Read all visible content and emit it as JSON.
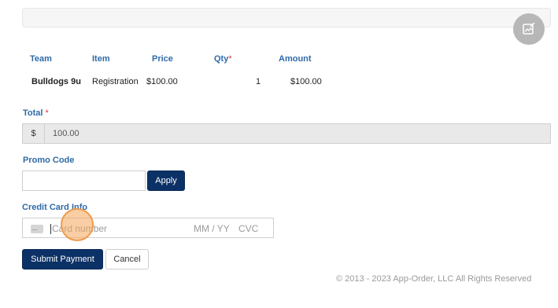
{
  "table": {
    "headers": {
      "team": "Team",
      "item": "Item",
      "price": "Price",
      "qty": "Qty",
      "amount": "Amount"
    },
    "required_mark": "*",
    "rows": [
      {
        "team": "Bulldogs 9u",
        "item": "Registration",
        "price": "$100.00",
        "qty": "1",
        "amount": "$100.00"
      }
    ]
  },
  "total": {
    "label": "Total",
    "required_mark": "*",
    "currency": "$",
    "value": "100.00"
  },
  "promo": {
    "label": "Promo Code",
    "value": "",
    "apply_label": "Apply"
  },
  "credit_card": {
    "label": "Credit Card Info",
    "number_placeholder": "Card number",
    "expiry_placeholder": "MM / YY",
    "cvc_placeholder": "CVC"
  },
  "actions": {
    "submit_label": "Submit Payment",
    "cancel_label": "Cancel"
  },
  "footer": {
    "copyright": "© 2013 - 2023 App-Order, LLC All Rights Reserved"
  },
  "icons": {
    "fab": "image-edit-icon",
    "card": "credit-card-icon"
  }
}
